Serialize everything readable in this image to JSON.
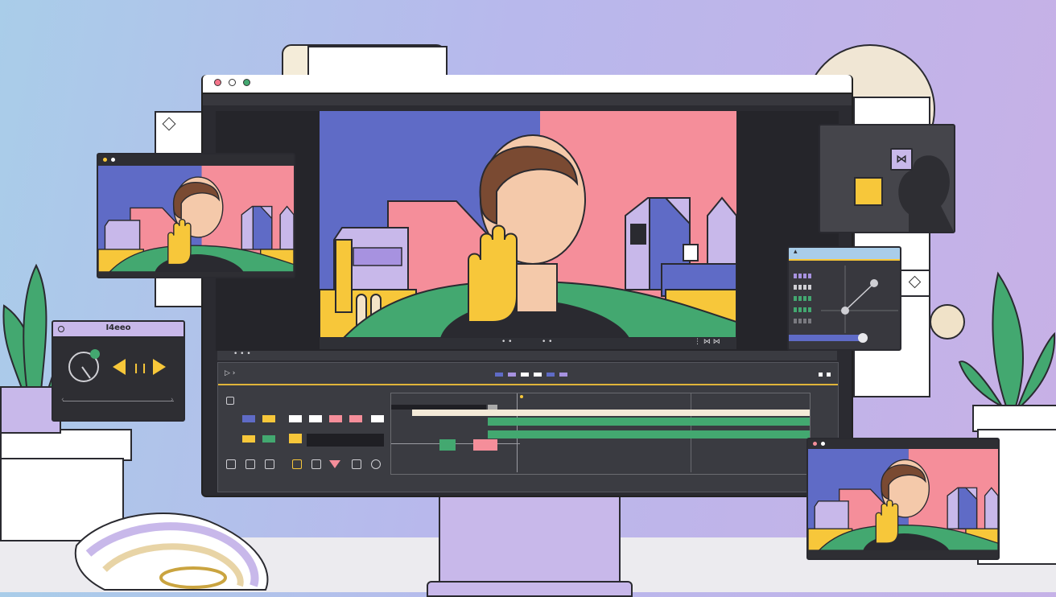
{
  "colors": {
    "sky_blue": "#5f6bc6",
    "pink": "#f58e9a",
    "green": "#43a870",
    "yellow": "#f7c73a",
    "lilac": "#c8b8ea",
    "dark_panel": "#2e2e33",
    "skin": "#f4c9aa",
    "hair": "#7a4a32"
  },
  "monitor": {
    "title_dots": [
      "red",
      "gray",
      "green"
    ]
  },
  "preview_scene": {
    "subject": "person-waving"
  },
  "left_widget": {
    "title": "I4eeo"
  },
  "editor": {
    "toolbar_icons": [
      "play-icon",
      "forward-icon"
    ],
    "timeline_tools": [
      "select-icon",
      "trim-icon",
      "cut-icon",
      "marker-icon",
      "pin-icon",
      "keyframe-icon",
      "slice-icon",
      "info-icon"
    ]
  },
  "right_panel": {
    "app_icon": "bowtie-icon"
  }
}
